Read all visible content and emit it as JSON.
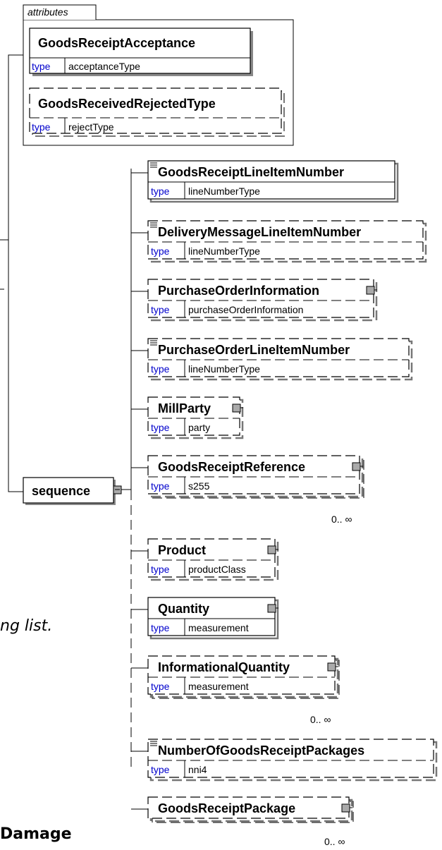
{
  "attributes_label": "attributes",
  "type_keyword": "type",
  "attributes": [
    {
      "name": "GoodsReceiptAcceptance",
      "type": "acceptanceType"
    },
    {
      "name": "GoodsReceivedRejectedType",
      "type": "rejectType"
    }
  ],
  "sequence_label": "sequence",
  "elements": [
    {
      "name": "GoodsReceiptLineItemNumber",
      "type": "lineNumberType"
    },
    {
      "name": "DeliveryMessageLineItemNumber",
      "type": "lineNumberType"
    },
    {
      "name": "PurchaseOrderInformation",
      "type": "purchaseOrderInformation"
    },
    {
      "name": "PurchaseOrderLineItemNumber",
      "type": "lineNumberType"
    },
    {
      "name": "MillParty",
      "type": "party"
    },
    {
      "name": "GoodsReceiptReference",
      "type": "s255",
      "cardinality": "0.. ∞"
    },
    {
      "name": "Product",
      "type": "productClass"
    },
    {
      "name": "Quantity",
      "type": "measurement"
    },
    {
      "name": "InformationalQuantity",
      "type": "measurement",
      "cardinality": "0.. ∞"
    },
    {
      "name": "NumberOfGoodsReceiptPackages",
      "type": "nni4"
    },
    {
      "name": "GoodsReceiptPackage",
      "type": "",
      "cardinality": "0.. ∞"
    }
  ],
  "text_fragments": {
    "italic": "ng list.",
    "bold": "Damage"
  }
}
